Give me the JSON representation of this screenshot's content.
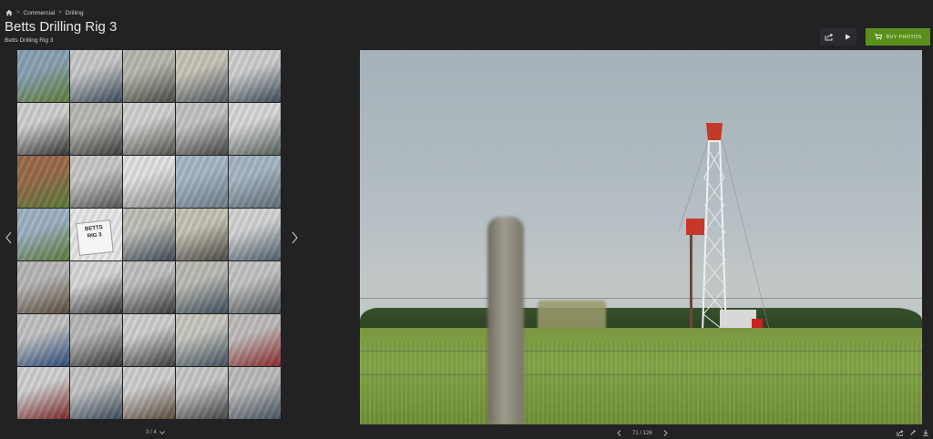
{
  "breadcrumb": {
    "items": [
      "Commercial",
      "Drilling"
    ]
  },
  "gallery": {
    "title": "Betts Drilling Rig 3",
    "subtitle": "Betts Drilling Rig 3",
    "page_indicator": "3 / 4"
  },
  "toolbar": {
    "buy_label": "BUY PHOTOS"
  },
  "viewer": {
    "counter": "71 / 126"
  },
  "thumbnail_labels": {
    "sign_line1": "BETTS",
    "sign_line2": "RIG 3"
  },
  "thumbnails": [
    {
      "c1": "#8aa2b4",
      "c2": "#5f7d3a"
    },
    {
      "c1": "#c9c9c9",
      "c2": "#3a4a5a"
    },
    {
      "c1": "#b8b8b0",
      "c2": "#4a4a44"
    },
    {
      "c1": "#c8c4b8",
      "c2": "#4c5560"
    },
    {
      "c1": "#cfcfcf",
      "c2": "#3c4a56"
    },
    {
      "c1": "#cfcfcf",
      "c2": "#333"
    },
    {
      "c1": "#b9bab5",
      "c2": "#3b3d3a"
    },
    {
      "c1": "#d0d0d0",
      "c2": "#54534c"
    },
    {
      "c1": "#c4c4c4",
      "c2": "#444"
    },
    {
      "c1": "#d8d8d8",
      "c2": "#556058"
    },
    {
      "c1": "#9a6a4a",
      "c2": "#5a7a3a"
    },
    {
      "c1": "#c8c8c8",
      "c2": "#555"
    },
    {
      "c1": "#e2e2e2",
      "c2": "#8a8a8a"
    },
    {
      "c1": "#a9b8c6",
      "c2": "#6d7c88"
    },
    {
      "c1": "#a6b6c4",
      "c2": "#5f6c76"
    },
    {
      "c1": "#9fb2c4",
      "c2": "#5d7a3c"
    },
    {
      "c1": "#e6e6e6",
      "c2": "#2c3a2c"
    },
    {
      "c1": "#c0c0b8",
      "c2": "#3e4a58"
    },
    {
      "c1": "#c6c2b6",
      "c2": "#4a4a40"
    },
    {
      "c1": "#d4d4d4",
      "c2": "#4c5c6a"
    },
    {
      "c1": "#b8b8b8",
      "c2": "#5a4a3a"
    },
    {
      "c1": "#d8d8d8",
      "c2": "#333"
    },
    {
      "c1": "#c0c0c0",
      "c2": "#3a3a3a"
    },
    {
      "c1": "#bcbcb4",
      "c2": "#3d4c5a"
    },
    {
      "c1": "#c4c4c4",
      "c2": "#4a5054"
    },
    {
      "c1": "#c2c2c2",
      "c2": "#2c4a7a"
    },
    {
      "c1": "#bababa",
      "c2": "#333"
    },
    {
      "c1": "#cfcfcf",
      "c2": "#3a3a3a"
    },
    {
      "c1": "#c8c8c0",
      "c2": "#40505e"
    },
    {
      "c1": "#c0bcbc",
      "c2": "#8a2a2a"
    },
    {
      "c1": "#d0d0d0",
      "c2": "#7a2a2a"
    },
    {
      "c1": "#c6c6c6",
      "c2": "#3c4a5a"
    },
    {
      "c1": "#cfcfcf",
      "c2": "#5a4a3a"
    },
    {
      "c1": "#c8c8c8",
      "c2": "#444"
    },
    {
      "c1": "#bcbcbc",
      "c2": "#4a5560"
    }
  ]
}
